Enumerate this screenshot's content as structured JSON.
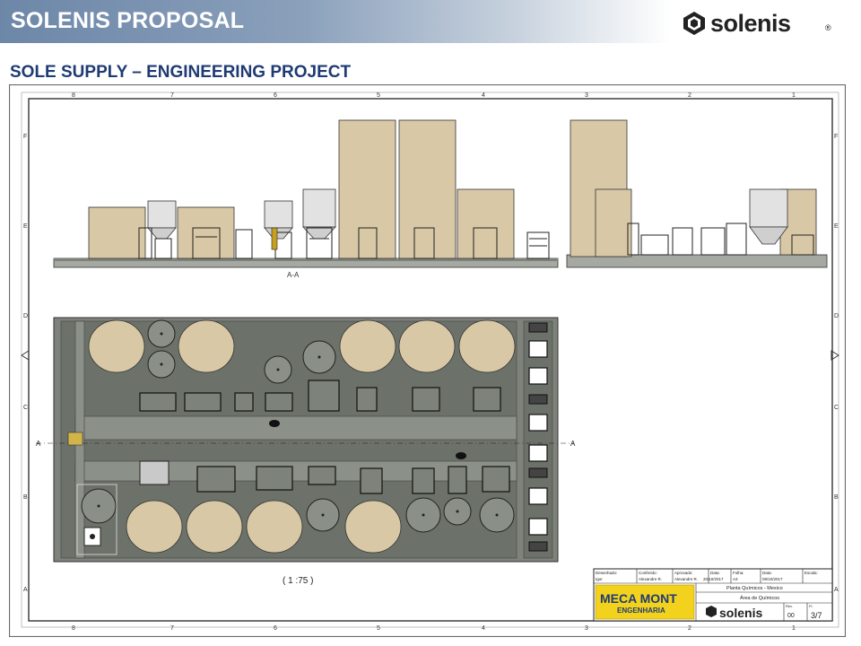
{
  "header": {
    "title": "SOLENIS PROPOSAL",
    "logo_text": "solenis",
    "logo_mark": "®"
  },
  "slide": {
    "subtitle": "SOLE SUPPLY – ENGINEERING PROJECT"
  },
  "drawing": {
    "section_label": "A-A",
    "scale_label": "( 1 :75 )",
    "section_marker_left": "A",
    "section_marker_right": "A",
    "top_grid_labels": [
      "8",
      "7",
      "6",
      "5",
      "4",
      "3",
      "2",
      "1"
    ],
    "bottom_grid_labels": [
      "8",
      "7",
      "6",
      "5",
      "4",
      "3",
      "2",
      "1"
    ],
    "side_grid_labels": [
      "F",
      "E",
      "D",
      "C",
      "B",
      "A"
    ]
  },
  "title_block": {
    "headers": [
      "Desenhado:",
      "Conferido:",
      "Aprovado:",
      "Data:",
      "Folha:",
      "Data:",
      "Escala:"
    ],
    "values": [
      "Igor",
      "Alexandre R.",
      "Alexandre R.",
      "20/10/2017",
      "A3",
      "09/10/2017",
      ""
    ],
    "project": "Planta Químicos - Mexico",
    "area": "Área de Químicos",
    "company_line1": "MECA MONT",
    "company_line2": "ENGENHARIA",
    "logo_text": "solenis",
    "rev_label": "Rev.",
    "rev_value": "00",
    "sheet_label": "Fl.",
    "sheet_value": "3/7"
  },
  "colors": {
    "tank": "#d8c8a6",
    "tank_dark": "#b8a682",
    "slab": "#7d827a",
    "slab_dark": "#5e635b",
    "subtitle": "#1f3b73",
    "meca_yellow": "#f3d21e"
  }
}
